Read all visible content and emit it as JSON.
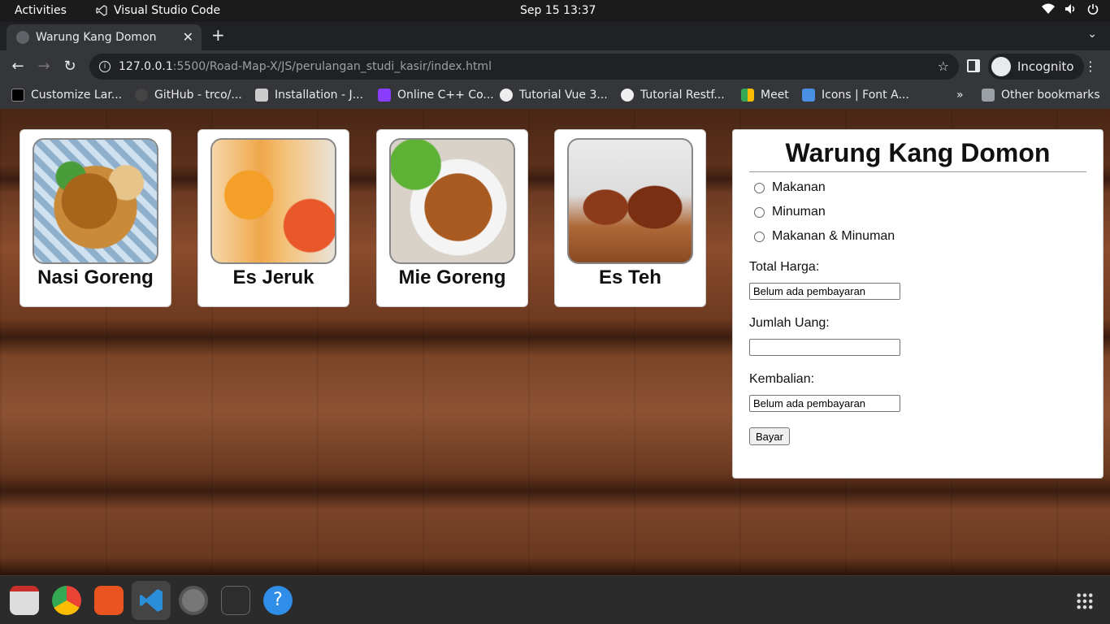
{
  "system": {
    "activities": "Activities",
    "app_name": "Visual Studio Code",
    "clock": "Sep 15  13:37",
    "icons": [
      "wifi-icon",
      "volume-icon",
      "power-icon"
    ]
  },
  "browser": {
    "tab_title": "Warung Kang Domon",
    "url_host": "127.0.0.1",
    "url_path": ":5500/Road-Map-X/JS/perulangan_studi_kasir/index.html",
    "incognito_label": "Incognito",
    "bookmarks": [
      {
        "label": "Customize Lar...",
        "icon": "dev-icon",
        "color": "#000000"
      },
      {
        "label": "GitHub - trco/...",
        "icon": "github-icon",
        "color": "#222222"
      },
      {
        "label": "Installation - J...",
        "icon": "book-icon",
        "color": "#111111"
      },
      {
        "label": "Online C++ Co...",
        "icon": "code-icon",
        "color": "#8a3cff"
      },
      {
        "label": "Tutorial Vue 3...",
        "icon": "skull-icon",
        "color": "#eeeeee"
      },
      {
        "label": "Tutorial Restf...",
        "icon": "skull-icon",
        "color": "#eeeeee"
      },
      {
        "label": "Meet",
        "icon": "meet-icon",
        "color": "#34a853"
      },
      {
        "label": "Icons | Font A...",
        "icon": "flag-icon",
        "color": "#4a90e2"
      }
    ],
    "overflow": "»",
    "other_bookmarks": "Other bookmarks"
  },
  "menu": [
    {
      "name": "Nasi Goreng",
      "icon": "nasi-goreng-photo"
    },
    {
      "name": "Es Jeruk",
      "icon": "es-jeruk-photo"
    },
    {
      "name": "Mie Goreng",
      "icon": "mie-goreng-photo"
    },
    {
      "name": "Es Teh",
      "icon": "es-teh-photo"
    }
  ],
  "cashier": {
    "title": "Warung Kang Domon",
    "options": [
      "Makanan",
      "Minuman",
      "Makanan & Minuman"
    ],
    "total_label": "Total Harga:",
    "total_value": "Belum ada pembayaran",
    "money_label": "Jumlah Uang:",
    "money_value": "",
    "change_label": "Kembalian:",
    "change_value": "Belum ada pembayaran",
    "pay_button": "Bayar"
  },
  "dock": [
    "files-icon",
    "chrome-icon",
    "app-center-icon",
    "vscode-icon",
    "settings-icon",
    "terminal-icon",
    "help-icon",
    "show-apps-icon"
  ]
}
